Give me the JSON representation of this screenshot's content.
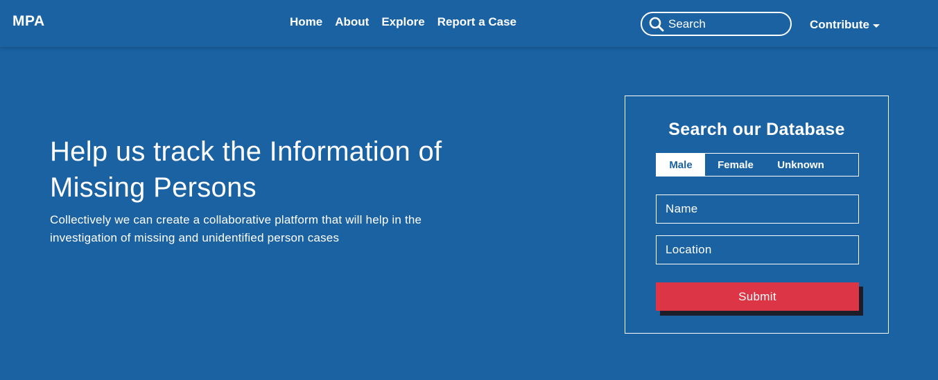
{
  "navbar": {
    "brand": "MPA",
    "links": [
      "Home",
      "About",
      "Explore",
      "Report a Case"
    ],
    "search_placeholder": "Search",
    "contribute_label": "Contribute"
  },
  "hero": {
    "title": "Help us track the Information of Missing Persons",
    "subtitle": "Collectively we can create a collaborative platform that will help in the investigation of missing and unidentified person cases"
  },
  "search_card": {
    "title": "Search our Database",
    "gender_options": [
      "Male",
      "Female",
      "Unknown"
    ],
    "selected_gender": "Male",
    "name_placeholder": "Name",
    "location_placeholder": "Location",
    "submit_label": "Submit"
  },
  "colors": {
    "background": "#1b62a3",
    "submit": "#dc3545",
    "text": "#ffffff"
  }
}
